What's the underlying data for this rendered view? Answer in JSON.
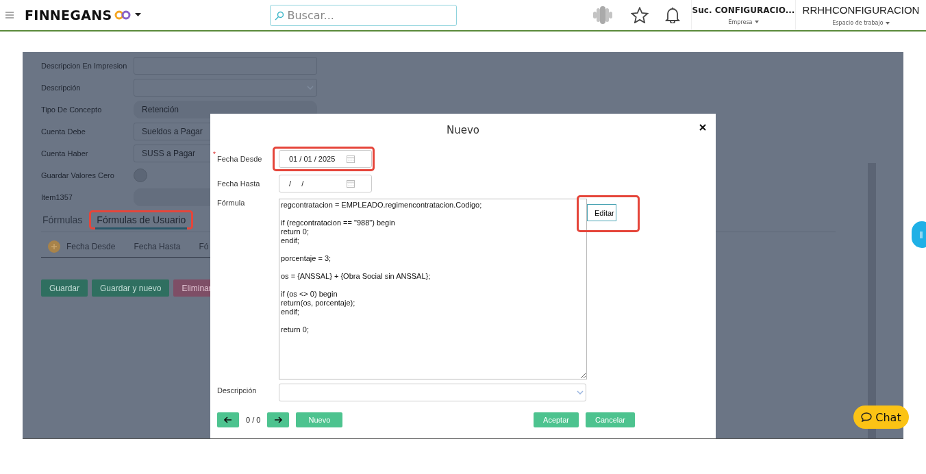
{
  "header": {
    "brand": "FINNEGANS",
    "search": {
      "placeholder": "Buscar..."
    },
    "company": {
      "name": "Suc. CONFIGURACIO...",
      "label": "Empresa"
    },
    "workspace": {
      "name": "RRHHCONFIGURACION",
      "label": "Espacio de trabajo"
    }
  },
  "background_form": {
    "fields": [
      {
        "label": "Descripcion En Impresion",
        "kind": "input"
      },
      {
        "label": "Descripción",
        "kind": "select"
      },
      {
        "label": "Tipo De Concepto",
        "kind": "readonly",
        "value": "Retención"
      },
      {
        "label": "Cuenta Debe",
        "kind": "input",
        "value": "Sueldos a Pagar"
      },
      {
        "label": "Cuenta Haber",
        "kind": "input",
        "value": "SUSS a Pagar"
      },
      {
        "label": "Guardar Valores Cero",
        "kind": "toggle",
        "on": false
      },
      {
        "label": "Item1357",
        "kind": "readonly"
      }
    ],
    "tabs": [
      {
        "label": "Fórmulas",
        "selected": false,
        "highlighted": false
      },
      {
        "label": "Fórmulas de Usuario",
        "selected": true,
        "highlighted": true
      }
    ],
    "grid_columns": [
      "Fecha Desde",
      "Fecha Hasta",
      "Fó"
    ],
    "buttons": [
      {
        "label": "Guardar",
        "kind": "primary"
      },
      {
        "label": "Guardar y nuevo",
        "kind": "primary"
      },
      {
        "label": "Eliminar",
        "kind": "danger"
      }
    ]
  },
  "dialog": {
    "title": "Nuevo",
    "fecha_desde": {
      "label": "Fecha Desde",
      "required_mark": "*",
      "value": "01 / 01 / 2025",
      "highlighted": true
    },
    "fecha_hasta": {
      "label": "Fecha Hasta",
      "value": "/     /",
      "highlighted": false
    },
    "formula": {
      "label": "Fórmula",
      "value": "regcontratacion = EMPLEADO.regimencontratacion.Codigo;\n\nif (regcontratacion == \"988\") begin\nreturn 0;\nendif;\n\nporcentaje = 3;\n\nos = {ANSSAL} + {Obra Social sin ANSSAL};\n\nif (os <> 0) begin\nreturn(os, porcentaje);\nendif;\n\nreturn 0;",
      "edit_button": {
        "label": "Editar",
        "highlighted": true
      }
    },
    "descripcion": {
      "label": "Descripción"
    },
    "pager": "0 / 0",
    "new_button": "Nuevo",
    "accept_button": "Aceptar",
    "cancel_button": "Cancelar"
  },
  "chat_button": "Chat"
}
